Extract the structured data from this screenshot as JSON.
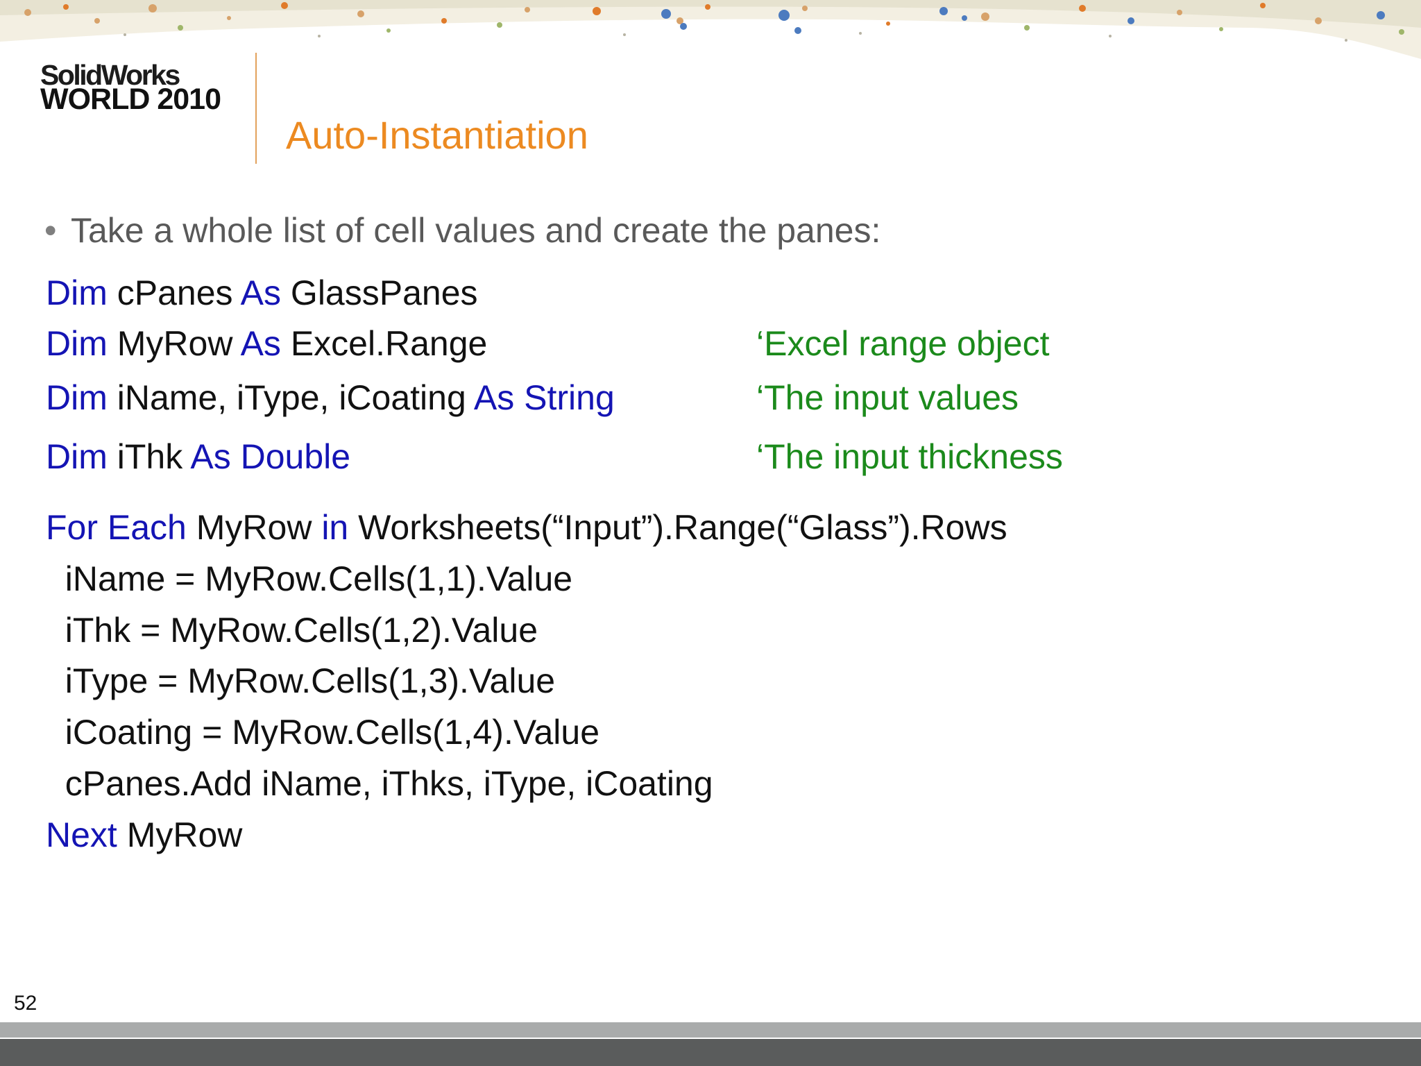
{
  "logo": {
    "line1": "SolidWorks",
    "line2": "WORLD 2010"
  },
  "title": "Auto-Instantiation",
  "bullet": "Take a whole list of cell values and create the panes:",
  "code": {
    "line1": {
      "kw1": "Dim",
      "t1": " cPanes ",
      "kw2": "As",
      "t2": " GlassPanes"
    },
    "line2": {
      "kw1": "Dim",
      "t1": " MyRow ",
      "kw2": "As",
      "t2": " Excel.Range",
      "comment": "‘Excel range object"
    },
    "line3": {
      "kw1": "Dim",
      "t1": " iName, iType, iCoating ",
      "kw2": "As String",
      "comment": "‘The input values"
    },
    "line4": {
      "kw1": "Dim",
      "t1": " iThk ",
      "kw2": "As Double",
      "comment": "‘The input thickness"
    },
    "line5": {
      "kw1": "For Each",
      "t1": " MyRow ",
      "kw2": "in",
      "t2": " Worksheets(“Input”).Range(“Glass”).Rows"
    },
    "line6": "  iName = MyRow.Cells(1,1).Value",
    "line7": "  iThk = MyRow.Cells(1,2).Value",
    "line8": "  iType = MyRow.Cells(1,3).Value",
    "line9": "  iCoating = MyRow.Cells(1,4).Value",
    "line10": "  cPanes.Add iName, iThks, iType, iCoating",
    "line11": {
      "kw1": "Next",
      "t1": " MyRow"
    }
  },
  "page_number": "52",
  "colors": {
    "title": "#ec8a21",
    "keyword": "#1414b4",
    "comment": "#1b8a1b",
    "bullet_text": "#595959",
    "code_text": "#111111"
  }
}
